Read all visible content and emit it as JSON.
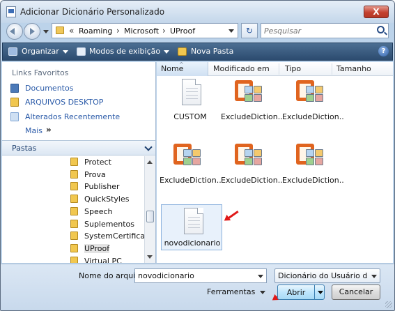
{
  "window": {
    "title": "Adicionar Dicionário Personalizado",
    "close_symbol": "X",
    "icon": "dictionary-doc-icon"
  },
  "address": {
    "chevrons": "«",
    "path": [
      "Roaming",
      "Microsoft",
      "UProof"
    ],
    "separator": "›",
    "refresh_symbol": "↻",
    "search_placeholder": "Pesquisar"
  },
  "toolbar": {
    "organize": "Organizar",
    "views": "Modos de exibição",
    "new_folder": "Nova Pasta",
    "help_symbol": "?"
  },
  "favorites": {
    "heading": "Links Favoritos",
    "items": [
      {
        "label": "Documentos",
        "icon": "documents-icon",
        "color": "#4b79b8"
      },
      {
        "label": "ARQUIVOS DESKTOP",
        "icon": "folder-icon",
        "color": "#f1c74f"
      },
      {
        "label": "Alterados Recentemente",
        "icon": "recent-changes-icon",
        "color": "#7fa4d4"
      }
    ],
    "more": "Mais",
    "more_chevron": "»"
  },
  "folders": {
    "heading": "Pastas",
    "items": [
      {
        "label": "Protect",
        "selected": false
      },
      {
        "label": "Prova",
        "selected": false
      },
      {
        "label": "Publisher",
        "selected": false
      },
      {
        "label": "QuickStyles",
        "selected": false
      },
      {
        "label": "Speech",
        "selected": false
      },
      {
        "label": "Suplementos",
        "selected": false
      },
      {
        "label": "SystemCertificates",
        "selected": false
      },
      {
        "label": "UProof",
        "selected": true
      },
      {
        "label": "Virtual PC",
        "selected": false
      }
    ]
  },
  "columns": {
    "name": "Nome",
    "modified": "Modificado em",
    "type": "Tipo",
    "size": "Tamanho",
    "sort_symbol": "^"
  },
  "files": [
    {
      "label": "CUSTOM",
      "icon": "text-document-icon"
    },
    {
      "label": "ExcludeDiction...",
      "icon": "office-file-icon"
    },
    {
      "label": "ExcludeDiction...",
      "icon": "office-file-icon"
    },
    {
      "label": "ExcludeDiction...",
      "icon": "office-file-icon"
    },
    {
      "label": "ExcludeDiction...",
      "icon": "office-file-icon"
    },
    {
      "label": "ExcludeDiction...",
      "icon": "office-file-icon"
    },
    {
      "label": "novodicionario",
      "icon": "text-document-icon",
      "selected": true
    }
  ],
  "bottom": {
    "filename_label": "Nome do arquivo:",
    "filename_value": "novodicionario",
    "filetype": "Dicionário do Usuário do Microsoft",
    "tools": "Ferramentas",
    "open": "Abrir",
    "cancel": "Cancelar"
  },
  "colors": {
    "accent_toolbar": "#3a5a80",
    "annotation_arrow": "#e01818",
    "office_orange": "#e0641f"
  }
}
